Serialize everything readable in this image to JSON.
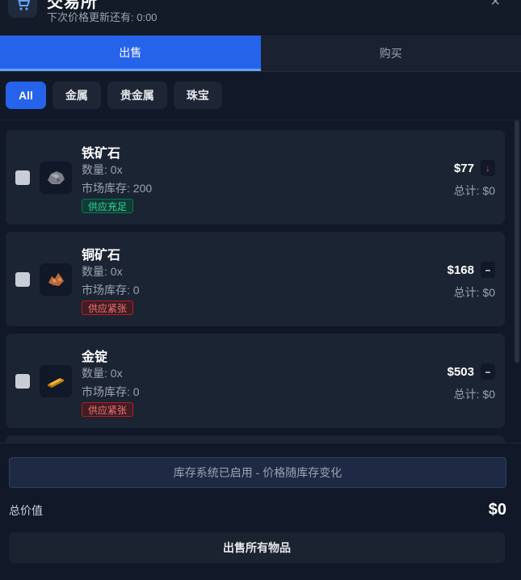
{
  "header": {
    "title": "交易所",
    "icon": "cart-icon",
    "subtitle": "下次价格更新还有: 0:00",
    "close_icon": "close-icon",
    "close_glyph": "×"
  },
  "tabs": [
    {
      "label": "出售",
      "active": true
    },
    {
      "label": "购买",
      "active": false
    }
  ],
  "filters": [
    {
      "label": "All",
      "active": true
    },
    {
      "label": "金属",
      "active": false
    },
    {
      "label": "贵金属",
      "active": false
    },
    {
      "label": "珠宝",
      "active": false
    }
  ],
  "items": [
    {
      "name": "铁矿石",
      "qty": "数量: 0x",
      "stock": "市场库存: 200",
      "badge": "供应充足",
      "badge_color": "#34d399",
      "price": "$77",
      "trend": "↓",
      "trend_color": "#ef4444",
      "total": "总计: $0",
      "icon": "iron-ore-icon"
    },
    {
      "name": "铜矿石",
      "qty": "数量: 0x",
      "stock": "市场库存: 0",
      "badge": "供应紧张",
      "badge_color": "#f87171",
      "price": "$168",
      "trend": "–",
      "trend_color": "#ffffff",
      "total": "总计: $0",
      "icon": "copper-ore-icon"
    },
    {
      "name": "金锭",
      "qty": "数量: 0x",
      "stock": "市场库存: 0",
      "badge": "供应紧张",
      "badge_color": "#f87171",
      "price": "$503",
      "trend": "–",
      "trend_color": "#ffffff",
      "total": "总计: $0",
      "icon": "gold-ingot-icon"
    }
  ],
  "footer": {
    "notice": "库存系统已启用 - 价格随库存变化",
    "total_label": "总价值",
    "total_value": "$0",
    "sell_all": "出售所有物品"
  },
  "colors": {
    "accent": "#2563eb",
    "background": "#111827",
    "card": "#1b2433"
  }
}
